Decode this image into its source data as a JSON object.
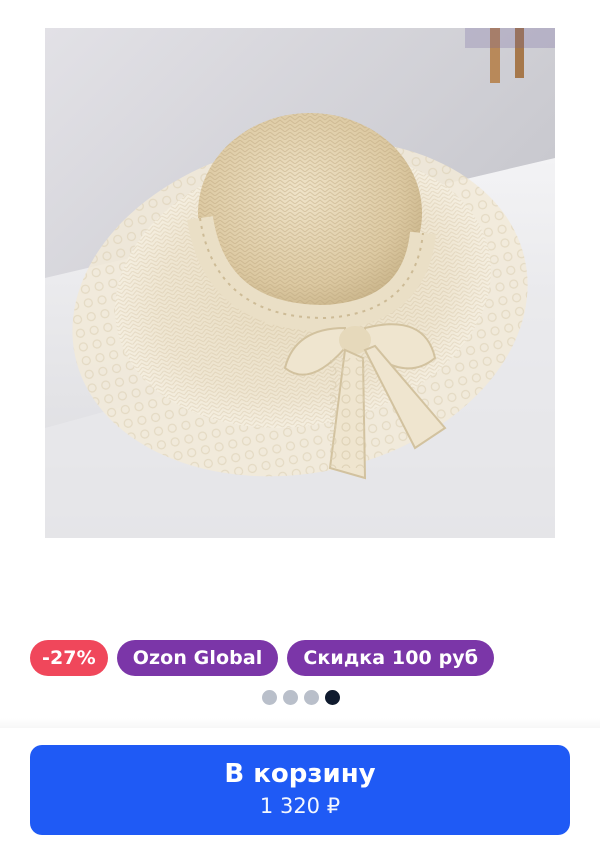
{
  "product": {
    "image_name": "straw-hat-photo"
  },
  "badges": {
    "discount": "-27%",
    "global": "Ozon Global",
    "promo": "Скидка 100 руб"
  },
  "carousel": {
    "total": 4,
    "active": 4
  },
  "cart": {
    "label": "В корзину",
    "price": "1 320 ₽"
  },
  "colors": {
    "discount_badge": "#f0475b",
    "global_badge": "#7b36a8",
    "cart_button": "#1f5af5",
    "dot_active": "#0f1a2e",
    "dot_inactive": "#b9bfca"
  }
}
